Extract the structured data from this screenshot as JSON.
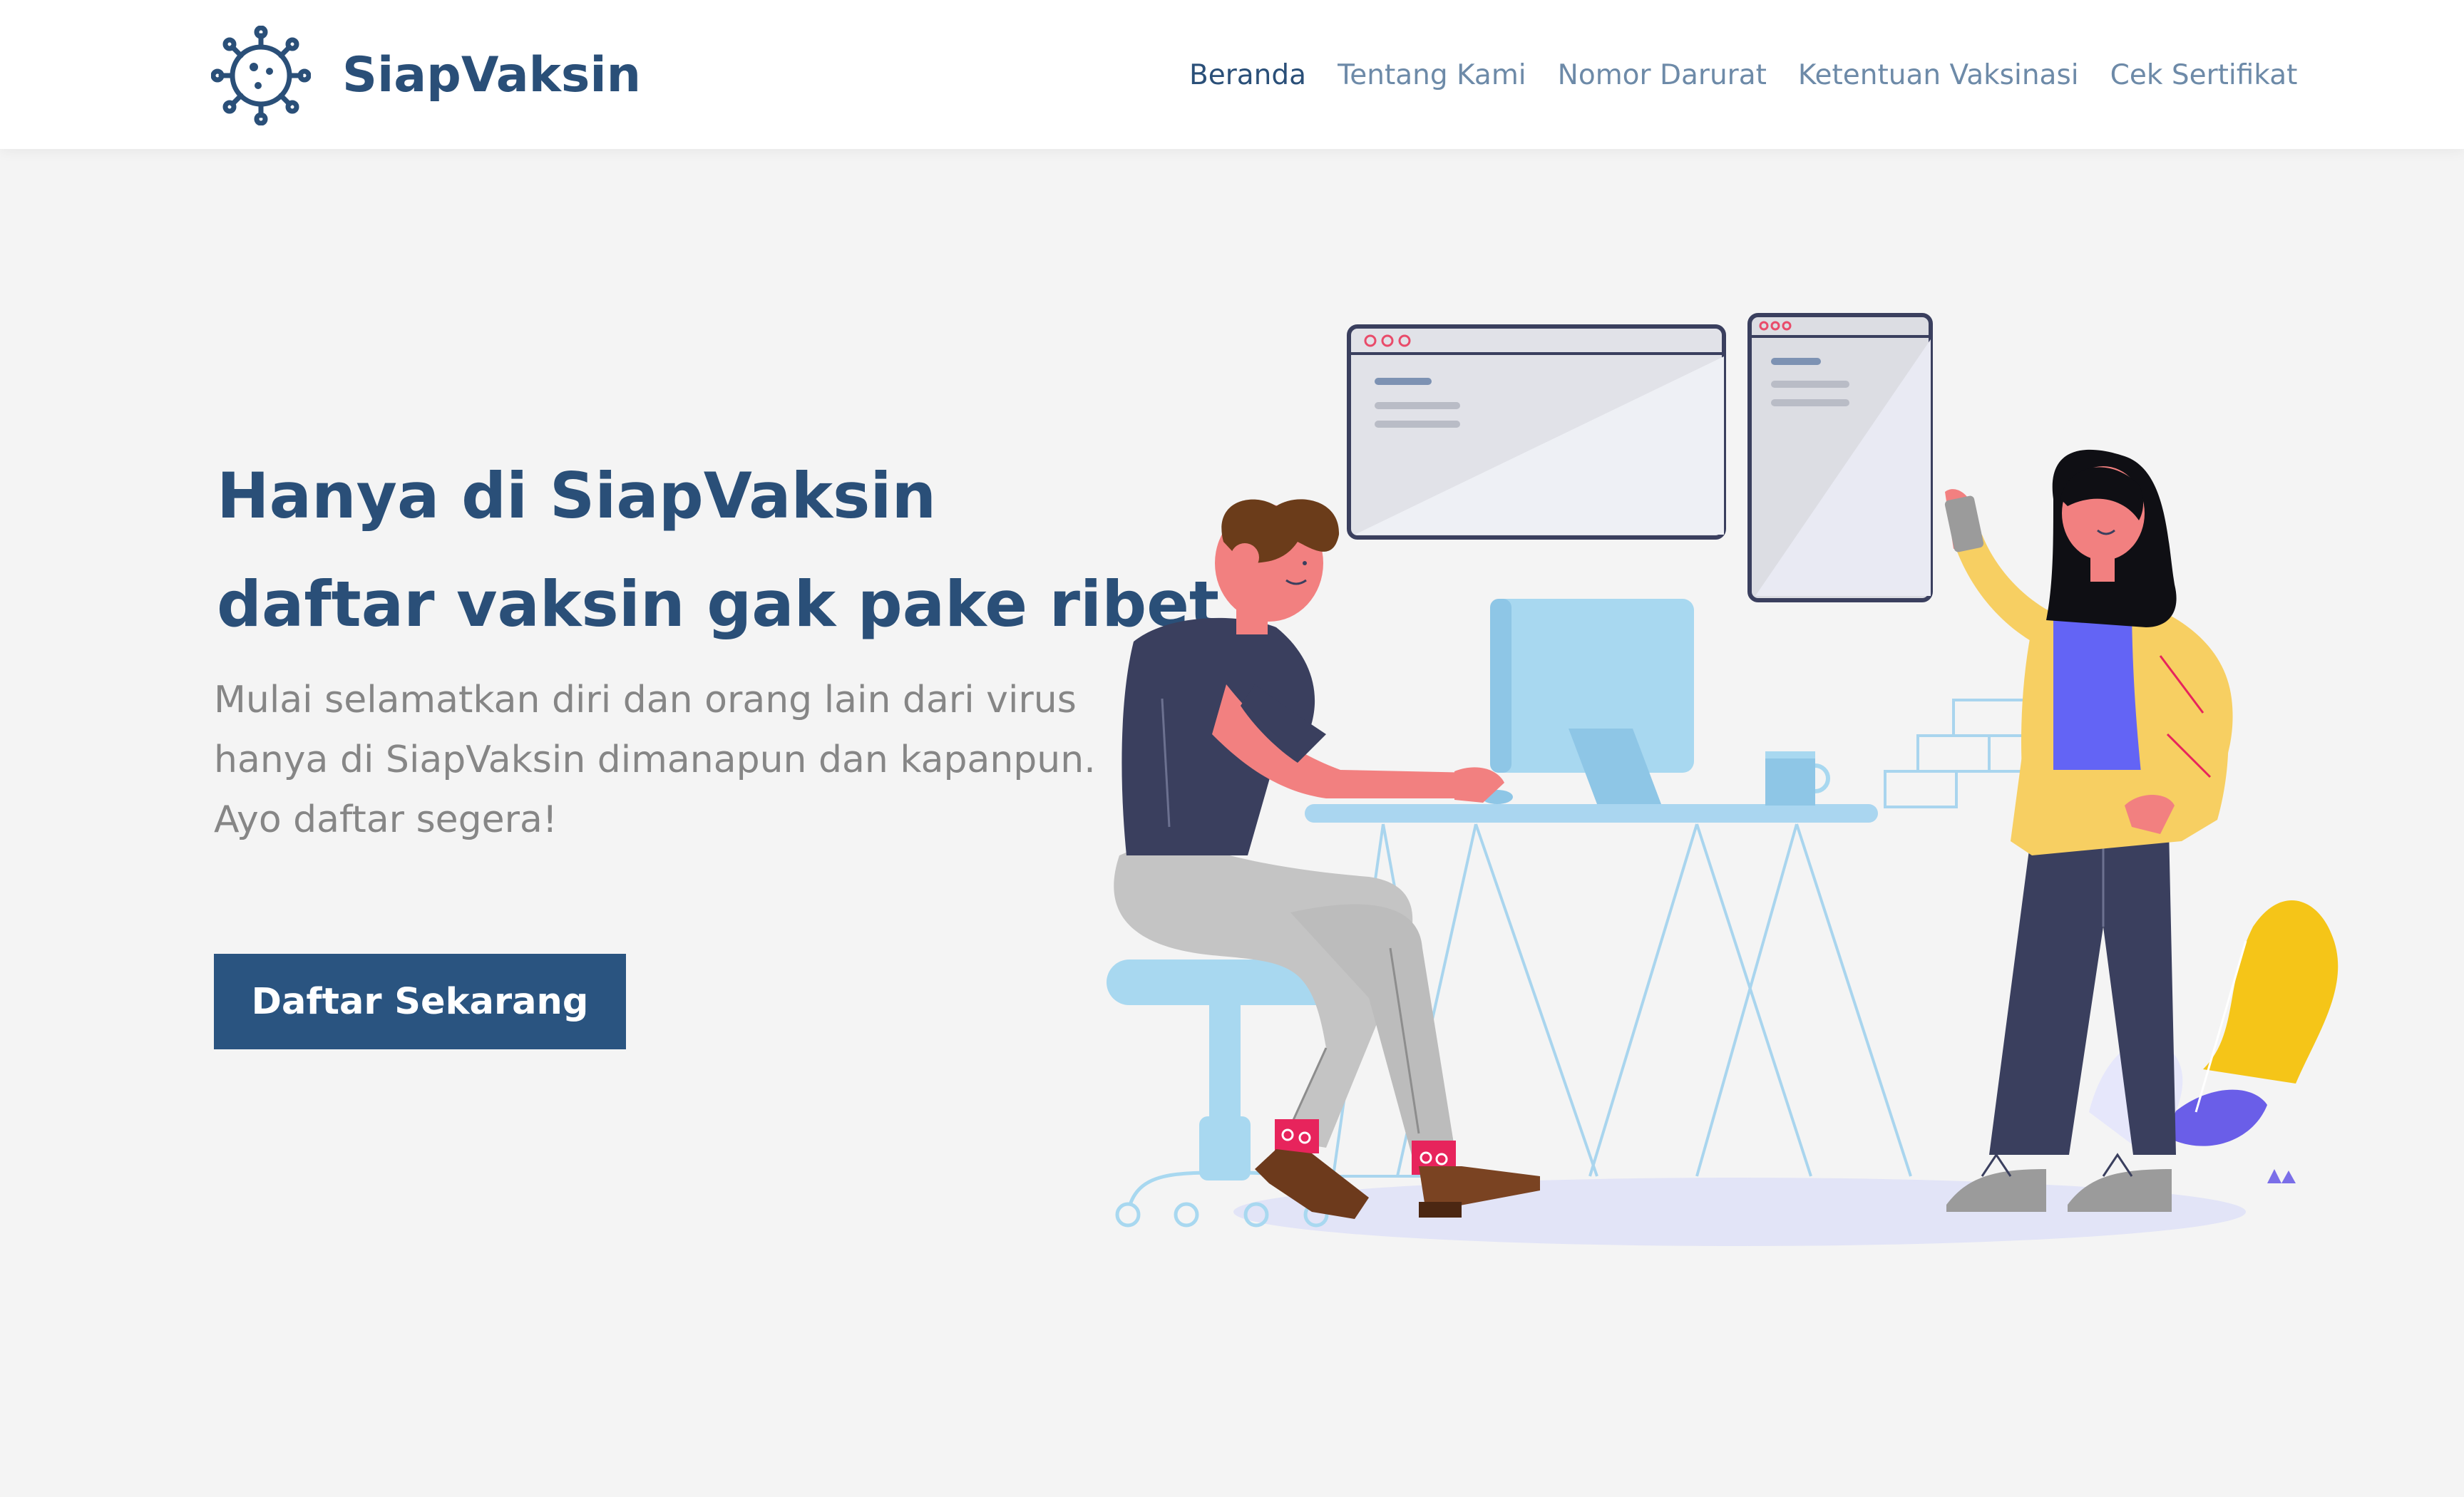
{
  "brand": {
    "name": "SiapVaksin",
    "logo_icon": "virus-icon"
  },
  "nav": {
    "items": [
      {
        "label": "Beranda",
        "active": true
      },
      {
        "label": "Tentang Kami",
        "active": false
      },
      {
        "label": "Nomor Darurat",
        "active": false
      },
      {
        "label": "Ketentuan Vaksinasi",
        "active": false
      },
      {
        "label": "Cek Sertifikat",
        "active": false
      }
    ]
  },
  "hero": {
    "title_line1": "Hanya di SiapVaksin",
    "title_line2": "daftar vaksin gak pake ribet",
    "description_line1": "Mulai selamatkan diri dan orang lain dari virus",
    "description_line2": "hanya di SiapVaksin dimanapun dan kapanpun.",
    "description_line3": "Ayo daftar segera!",
    "cta_label": "Daftar Sekarang"
  },
  "colors": {
    "brand": "#2a4f78",
    "button": "#2a5480",
    "nav_inactive": "#6d8aa8",
    "background": "#f4f4f4",
    "text_muted": "#868686"
  }
}
